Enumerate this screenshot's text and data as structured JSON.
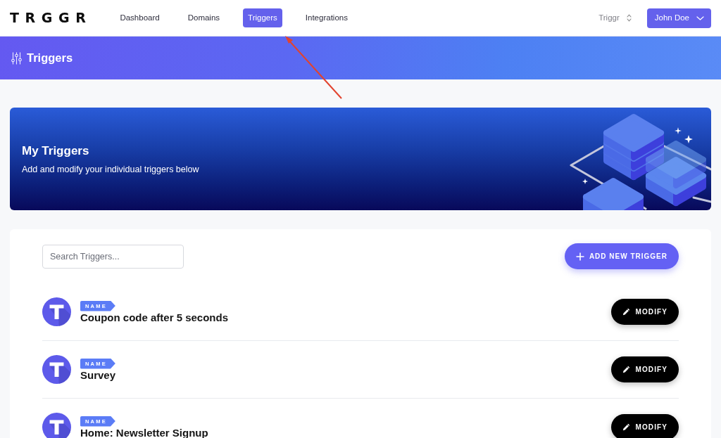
{
  "logo": "TRGGR",
  "nav": [
    {
      "label": "Dashboard",
      "selected": false
    },
    {
      "label": "Domains",
      "selected": false
    },
    {
      "label": "Triggers",
      "selected": true
    },
    {
      "label": "Integrations",
      "selected": false
    }
  ],
  "workspace": {
    "label": "Triggr"
  },
  "user_menu": {
    "label": "John Doe"
  },
  "page_header": {
    "title": "Triggers"
  },
  "hero": {
    "title": "My Triggers",
    "subtitle": "Add and modify your individual triggers below"
  },
  "search": {
    "placeholder": "Search Triggers..."
  },
  "add_button": {
    "label": "ADD NEW TRIGGER"
  },
  "triggers": [
    {
      "tag": "NAME",
      "name": "Coupon code after 5 seconds",
      "action": "MODIFY"
    },
    {
      "tag": "NAME",
      "name": "Survey",
      "action": "MODIFY"
    },
    {
      "tag": "NAME",
      "name": "Home: Newsletter Signup",
      "action": "MODIFY"
    }
  ]
}
